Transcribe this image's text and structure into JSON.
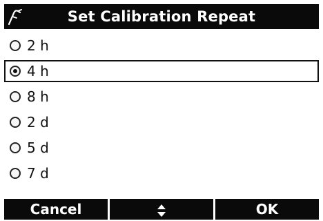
{
  "header": {
    "title": "Set Calibration Repeat",
    "icon": "probe-icon"
  },
  "options": [
    {
      "label": "2 h",
      "selected": false
    },
    {
      "label": "4 h",
      "selected": true
    },
    {
      "label": "8 h",
      "selected": false
    },
    {
      "label": "2 d",
      "selected": false
    },
    {
      "label": "5 d",
      "selected": false
    },
    {
      "label": "7 d",
      "selected": false
    }
  ],
  "softkeys": {
    "cancel": "Cancel",
    "nav_icon": "up-down-arrows-icon",
    "ok": "OK"
  },
  "colors": {
    "bar_bg": "#0a0a0a",
    "bar_text": "#ffffff",
    "screen_bg": "#ffffff"
  }
}
